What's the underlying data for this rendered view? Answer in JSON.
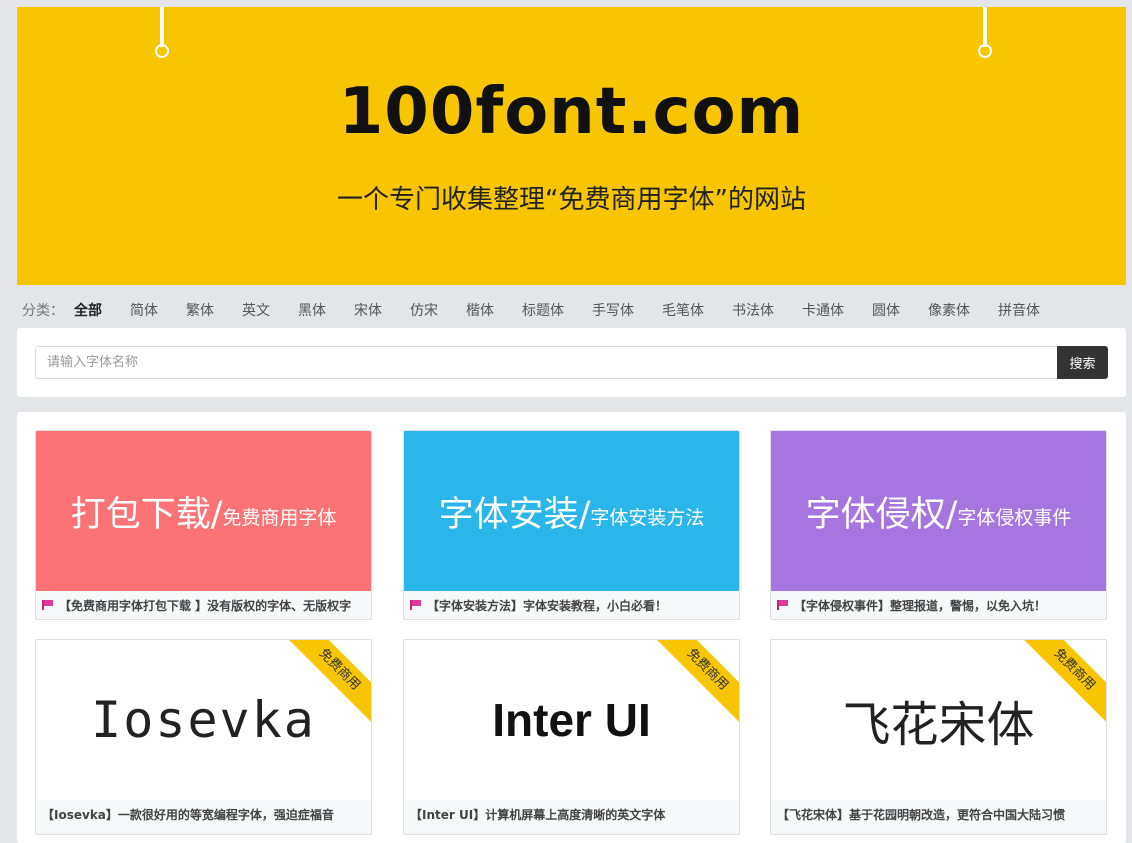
{
  "banner": {
    "title": "100font.com",
    "subtitle": "一个专门收集整理“免费商用字体”的网站"
  },
  "categories": {
    "label": "分类：",
    "items": [
      "全部",
      "简体",
      "繁体",
      "英文",
      "黑体",
      "宋体",
      "仿宋",
      "楷体",
      "标题体",
      "手写体",
      "毛笔体",
      "书法体",
      "卡通体",
      "圆体",
      "像素体",
      "拼音体"
    ],
    "active": "全部"
  },
  "search": {
    "placeholder": "请输入字体名称",
    "value": "",
    "button_label": "搜索"
  },
  "promo_cards": [
    {
      "big": "打包下载/",
      "small": "免费商用字体",
      "caption": "【免费商用字体打包下载 】没有版权的字体、无版权字",
      "color": "#fb7374",
      "icon": "flag-icon"
    },
    {
      "big": "字体安装/",
      "small": "字体安装方法",
      "caption": "【字体安装方法】字体安装教程，小白必看！",
      "color": "#2bb6eb",
      "icon": "flag-icon"
    },
    {
      "big": "字体侵权/",
      "small": "字体侵权事件",
      "caption": "【字体侵权事件】整理报道，警惕，以免入坑！",
      "color": "#a676e0",
      "icon": "flag-icon"
    }
  ],
  "font_cards": [
    {
      "sample": "Iosevka",
      "ribbon": "免费商用",
      "caption": "【Iosevka】一款很好用的等宽编程字体，强迫症福音"
    },
    {
      "sample": "Inter UI",
      "ribbon": "免费商用",
      "caption": "【Inter UI】计算机屏幕上高度清晰的英文字体"
    },
    {
      "sample": "飞花宋体",
      "ribbon": "免费商用",
      "caption": "【飞花宋体】基于花园明朝改造，更符合中国大陆习惯"
    }
  ],
  "colors": {
    "banner": "#f7c600",
    "ribbon": "#f7c600",
    "search_button": "#333333"
  }
}
